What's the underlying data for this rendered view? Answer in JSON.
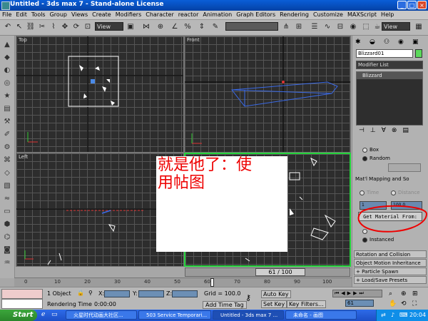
{
  "window": {
    "title": "Untitled - 3ds max 7 - Stand-alone License"
  },
  "menu": [
    "File",
    "Edit",
    "Tools",
    "Group",
    "Views",
    "Create",
    "Modifiers",
    "Character",
    "reactor",
    "Animation",
    "Graph Editors",
    "Rendering",
    "Customize",
    "MAXScript",
    "Help"
  ],
  "toolbar": {
    "view_dropdown": "View",
    "view_dropdown2": "View"
  },
  "viewports": {
    "top": "Top",
    "front": "Front",
    "left": "Left"
  },
  "overlay_note": {
    "line1": "就是他了：使",
    "line2": "用帖图"
  },
  "command_panel": {
    "object_name": "Blizzard01",
    "modifier_list": "Modifier List",
    "stack_item": "Blizzard",
    "radio_box": "Box",
    "radio_random": "Random",
    "mapping_rollout": "Mat'l Mapping and So",
    "get_material_button": "Get Material From:",
    "instanced": "Instanced",
    "rollout_rotation": "Rotation and Collision",
    "rollout_motion": "Object Motion Inheritance",
    "rollout_spawn": "+ Particle Spawn",
    "rollout_presets": "+ Load/Save Presets",
    "spin_count": "1",
    "spin_value": "100.0"
  },
  "timeslider": {
    "label": "61 / 100",
    "frame": 61,
    "max": 100
  },
  "track_ticks": [
    "0",
    "10",
    "20",
    "30",
    "40",
    "50",
    "60",
    "70",
    "80",
    "90",
    "100"
  ],
  "status": {
    "selection": "1 Object",
    "x_label": "X:",
    "y_label": "Y:",
    "z_label": "Z:",
    "grid": "Grid = 100.0",
    "auto_key": "Auto Key",
    "set_key": "Set Key",
    "key_filters": "Key Filters...",
    "rendering_time_label": "Rendering Time",
    "rendering_time": "0:00:00",
    "add_time_tag": "Add Time Tag",
    "frame_field": "61"
  },
  "taskbar": {
    "start": "Start",
    "tasks": [
      "火星时代动画大社区...",
      "503 Service Temporari...",
      "Untitled - 3ds max 7 ...",
      "未命名 - 画图"
    ],
    "clock": "20:04"
  },
  "colors": {
    "active_viewport": "#23d23a",
    "overlay_text": "#e00000",
    "taskbar": "#245edb",
    "annotation_circle": "#e00000"
  }
}
